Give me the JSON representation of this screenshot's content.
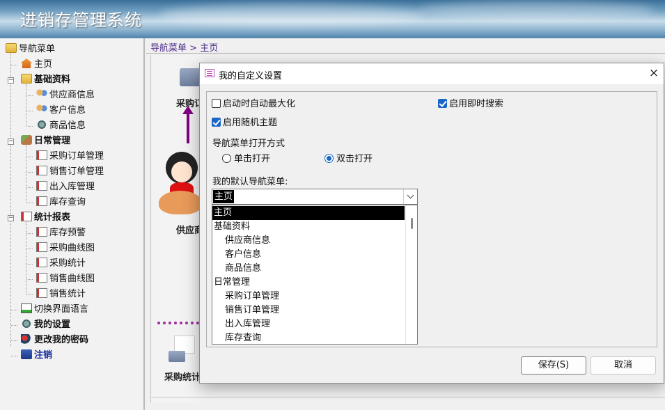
{
  "app": {
    "title": "进销存管理系统"
  },
  "breadcrumb": {
    "root": "导航菜单",
    "sep": ">",
    "current": "主页"
  },
  "sidebar": {
    "root": "导航菜单",
    "items": [
      {
        "label": "主页",
        "icon": "home-icon"
      },
      {
        "label": "基础资料",
        "icon": "folder-open-icon",
        "group": true
      },
      {
        "label": "供应商信息",
        "icon": "people-icon"
      },
      {
        "label": "客户信息",
        "icon": "people-icon"
      },
      {
        "label": "商品信息",
        "icon": "gear-icon"
      },
      {
        "label": "日常管理",
        "icon": "tools-icon",
        "group": true
      },
      {
        "label": "采购订单管理",
        "icon": "document-icon"
      },
      {
        "label": "销售订单管理",
        "icon": "document-icon"
      },
      {
        "label": "出入库管理",
        "icon": "document-icon"
      },
      {
        "label": "库存查询",
        "icon": "document-icon"
      },
      {
        "label": "统计报表",
        "icon": "document-icon",
        "group": true
      },
      {
        "label": "库存预警",
        "icon": "document-icon"
      },
      {
        "label": "采购曲线图",
        "icon": "document-icon"
      },
      {
        "label": "采购统计",
        "icon": "document-icon"
      },
      {
        "label": "销售曲线图",
        "icon": "document-icon"
      },
      {
        "label": "销售统计",
        "icon": "document-icon"
      },
      {
        "label": "切换界面语言",
        "icon": "chart-icon"
      },
      {
        "label": "我的设置",
        "icon": "gear-icon"
      },
      {
        "label": "更改我的密码",
        "icon": "key-icon"
      },
      {
        "label": "注销",
        "icon": "exit-icon"
      }
    ]
  },
  "main": {
    "flow_labels": {
      "purchase": "采购订",
      "supplier": "供应商",
      "purchase_stats": "采购统计"
    }
  },
  "dialog": {
    "title": "我的自定义设置",
    "close": "×",
    "auto_maximize": {
      "label": "启动时自动最大化",
      "checked": false
    },
    "instant_search": {
      "label": "启用即时搜索",
      "checked": true
    },
    "random_theme": {
      "label": "启用随机主题",
      "checked": true
    },
    "open_mode_label": "导航菜单打开方式",
    "single_click": {
      "label": "单击打开",
      "selected": false
    },
    "double_click": {
      "label": "双击打开",
      "selected": true
    },
    "default_menu_label": "我的默认导航菜单:",
    "default_menu_value": "主页",
    "options": [
      {
        "label": "主页",
        "indent": 0
      },
      {
        "label": "基础资料",
        "indent": 0
      },
      {
        "label": "供应商信息",
        "indent": 1
      },
      {
        "label": "客户信息",
        "indent": 1
      },
      {
        "label": "商品信息",
        "indent": 1
      },
      {
        "label": "日常管理",
        "indent": 0
      },
      {
        "label": "采购订单管理",
        "indent": 1
      },
      {
        "label": "销售订单管理",
        "indent": 1
      },
      {
        "label": "出入库管理",
        "indent": 1
      },
      {
        "label": "库存查询",
        "indent": 1
      }
    ],
    "save": "保存(S)",
    "cancel": "取消"
  },
  "colors": {
    "accent": "#1a66c8",
    "breadcrumb": "#4a2a8a",
    "arrow": "#800080",
    "logout": "#1a2f9a"
  }
}
